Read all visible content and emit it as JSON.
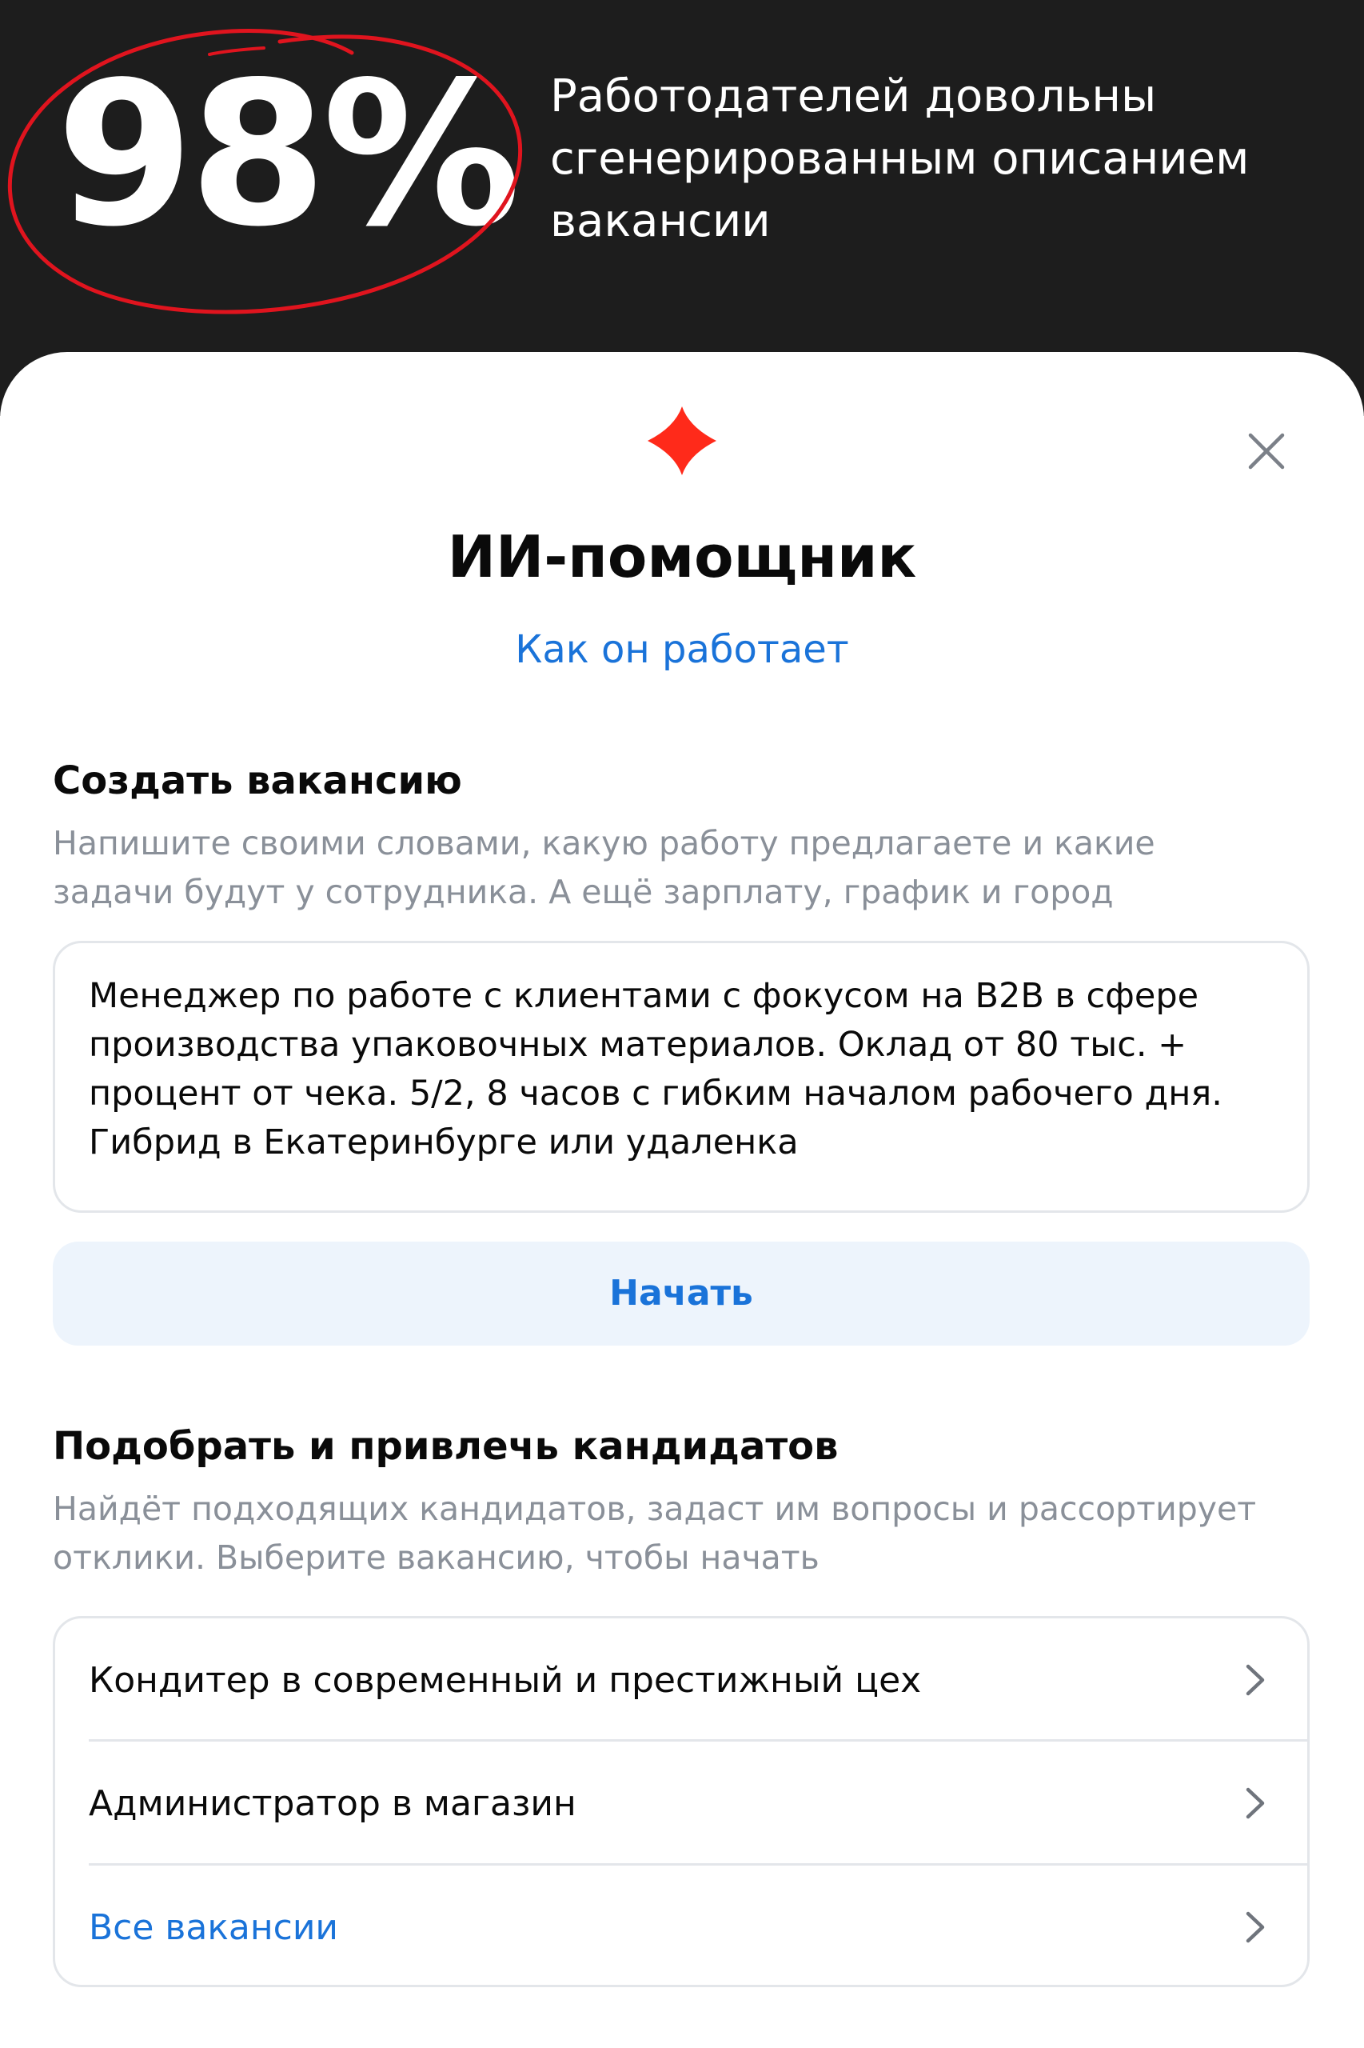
{
  "banner": {
    "stat": "98%",
    "caption_lines": [
      "Работодателей довольны",
      "сгенерированным описанием",
      "вакансии"
    ],
    "circle_color": "#e0141e",
    "background": "#1d1d1d"
  },
  "dialog": {
    "logo_icon": "red-diamond-icon",
    "logo_color": "#ff2a1a",
    "close_icon": "close-icon",
    "title": "ИИ-помощник",
    "how_link": "Как он работает"
  },
  "create": {
    "title": "Создать вакансию",
    "description_lines": [
      "Напишите своими словами, какую работу предлагаете и какие",
      "задачи будут у сотрудника. А ещё зарплату, график и город"
    ],
    "input_lines": [
      "Менеджер по работе с клиентами с фокусом на B2B в сфере",
      "производства упаковочных материалов. Оклад от 80 тыс. +",
      "процент от чека. 5/2, 8 часов с гибким началом рабочего дня.",
      "Гибрид в Екатеринбурге или удаленка"
    ],
    "start_button": "Начать"
  },
  "candidates": {
    "title": "Подобрать и привлечь кандидатов",
    "description_lines": [
      "Найдёт подходящих кандидатов, задаст им вопросы и рассортирует",
      "отклики. Выберите вакансию, чтобы начать"
    ],
    "items": [
      {
        "label": "Кондитер в современный и престижный цех"
      },
      {
        "label": "Администратор в магазин"
      },
      {
        "label": "Все вакансии"
      }
    ]
  },
  "colors": {
    "accent": "#1a73d9",
    "muted_text": "#8a9099",
    "border": "#e3e6ea",
    "button_bg": "#edf4fc"
  }
}
